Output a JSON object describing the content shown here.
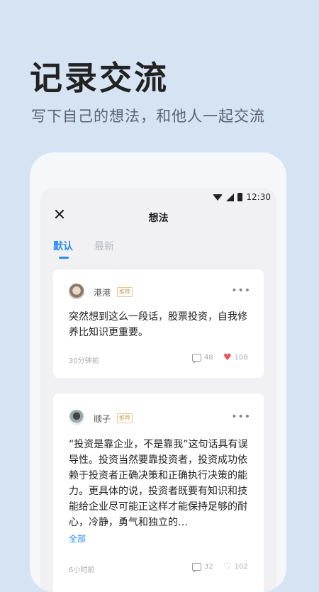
{
  "hero": {
    "title": "记录交流",
    "subtitle": "写下自己的想法，和他人一起交流"
  },
  "status_bar": {
    "time": "12:30"
  },
  "nav": {
    "title": "想法",
    "close_icon": "close-icon"
  },
  "tabs": [
    {
      "label": "默认",
      "active": true
    },
    {
      "label": "最新",
      "active": false
    }
  ],
  "posts": [
    {
      "username": "港港",
      "badge": "推荐",
      "text": "突然想到这么一段话，股票投资，自我修养比知识更重要。",
      "time": "30分钟前",
      "comments": "48",
      "likes": "108",
      "liked": true
    },
    {
      "username": "顺子",
      "badge": "推荐",
      "text": "“投资是靠企业，不是靠我”这句话具有误导性。投资当然要靠投资者，投资成功依赖于投资者正确决策和正确执行决策的能力。更具体的说，投资者既要有知识和技能给企业尽可能正这样才能保持足够的耐心，冷静，勇气和独立的…",
      "read_more": "全部",
      "time": "6小时前",
      "comments": "32",
      "likes": "102",
      "liked": false
    }
  ],
  "colors": {
    "accent": "#2b8cf3",
    "background": "#d6e3f3",
    "heart": "#f0505a"
  }
}
